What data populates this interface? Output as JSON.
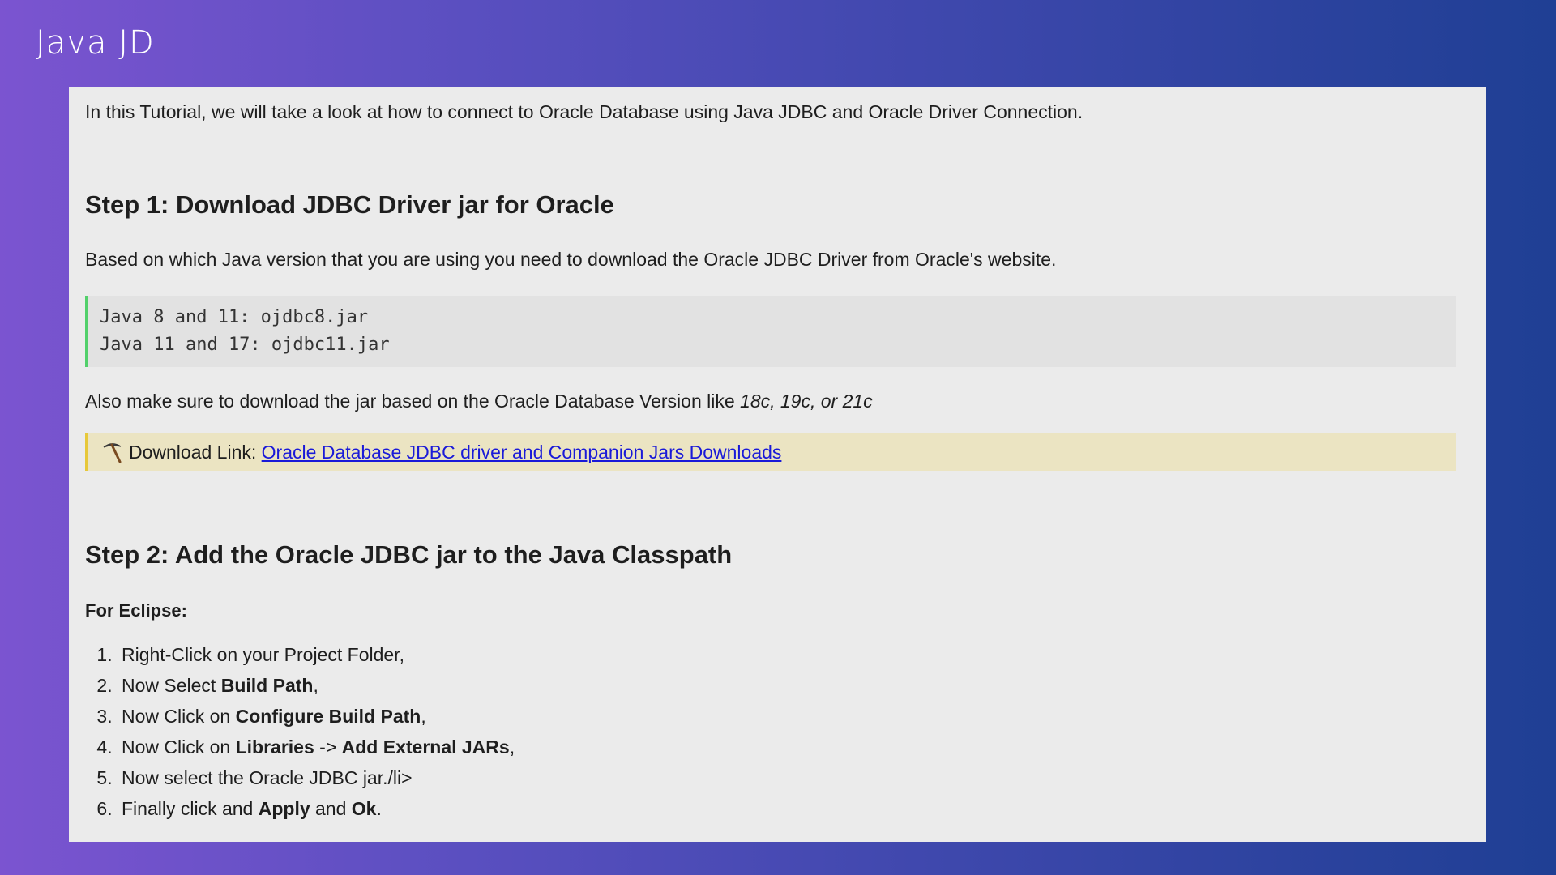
{
  "slide": {
    "title": "Java JD"
  },
  "content": {
    "intro": "In this Tutorial, we will take a look at how to connect to Oracle Database using Java JDBC and Oracle Driver Connection.",
    "step1": {
      "heading": "Step 1: Download JDBC Driver jar for Oracle",
      "description": "Based on which Java version that you are using you need to download the Oracle JDBC Driver from Oracle's website.",
      "code_lines": [
        "Java 8 and 11: ojdbc8.jar",
        "Java 11 and 17: ojdbc11.jar"
      ],
      "note_prefix": "Also make sure to download the jar based on the Oracle Database Version like ",
      "note_versions": "18c, 19c, or 21c",
      "download_label": "Download Link: ",
      "download_link_text": "Oracle Database JDBC driver and Companion Jars Downloads",
      "download_icon": "pick-icon"
    },
    "step2": {
      "heading": "Step 2: Add the Oracle JDBC jar to the Java Classpath",
      "subheading": "For Eclipse:",
      "items": [
        {
          "pre": "Right-Click on your Project Folder,",
          "b1": "",
          "mid": "",
          "b2": "",
          "post": ""
        },
        {
          "pre": "Now Select ",
          "b1": "Build Path",
          "mid": ",",
          "b2": "",
          "post": ""
        },
        {
          "pre": "Now Click on ",
          "b1": "Configure Build Path",
          "mid": ",",
          "b2": "",
          "post": ""
        },
        {
          "pre": "Now Click on ",
          "b1": "Libraries",
          "mid": " -> ",
          "b2": "Add External JARs",
          "post": ","
        },
        {
          "pre": "Now select the Oracle JDBC jar./li>",
          "b1": "",
          "mid": "",
          "b2": "",
          "post": ""
        },
        {
          "pre": "Finally click and ",
          "b1": "Apply",
          "mid": " and ",
          "b2": "Ok",
          "post": "."
        }
      ]
    }
  }
}
